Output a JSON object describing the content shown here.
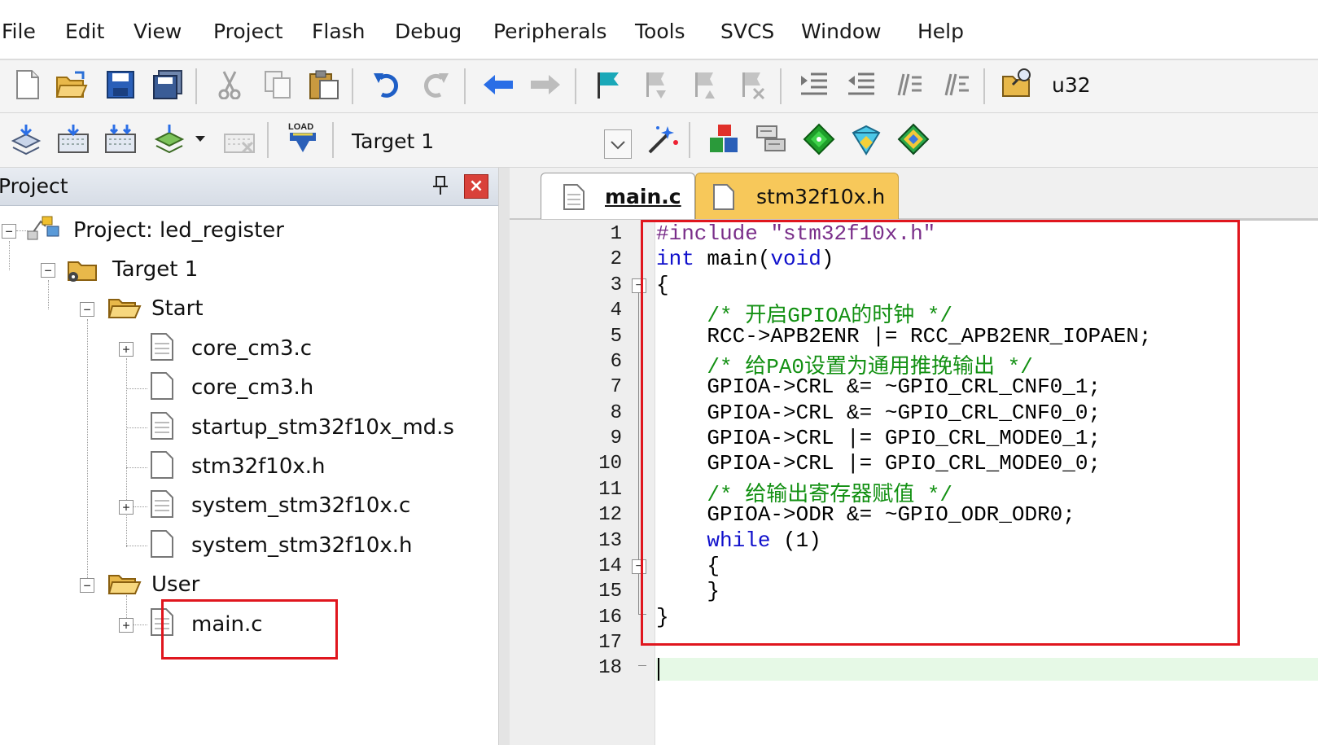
{
  "menu": [
    "File",
    "Edit",
    "View",
    "Project",
    "Flash",
    "Debug",
    "Peripherals",
    "Tools",
    "SVCS",
    "Window",
    "Help"
  ],
  "toolbar1": {
    "search_text": "u32"
  },
  "toolbar2": {
    "target_select": "Target 1"
  },
  "project_panel": {
    "title": "Project",
    "pin_glyph": "♒",
    "close_glyph": "×",
    "tree": {
      "root": "Project: led_register",
      "target": "Target 1",
      "start_group": "Start",
      "start_files": [
        "core_cm3.c",
        "core_cm3.h",
        "startup_stm32f10x_md.s",
        "stm32f10x.h",
        "system_stm32f10x.c",
        "system_stm32f10x.h"
      ],
      "user_group": "User",
      "user_files": [
        "main.c"
      ]
    }
  },
  "editor": {
    "tabs": [
      "main.c",
      "stm32f10x.h"
    ],
    "active_tab": "main.c",
    "line_numbers": [
      "1",
      "2",
      "3",
      "4",
      "5",
      "6",
      "7",
      "8",
      "9",
      "10",
      "11",
      "12",
      "13",
      "14",
      "15",
      "16",
      "17",
      "18"
    ],
    "code": {
      "l1_pre": "#include ",
      "l1_str": "\"stm32f10x.h\"",
      "l2_kw": "int",
      "l2_mid": " main(",
      "l2_kw2": "void",
      "l2_end": ")",
      "l3": "{",
      "l4": "    /* 开启GPIOA的时钟 */",
      "l5": "    RCC->APB2ENR |= RCC_APB2ENR_IOPAEN;",
      "l6": "    /* 给PA0设置为通用推挽输出 */",
      "l7": "    GPIOA->CRL &= ~GPIO_CRL_CNF0_1;",
      "l8": "    GPIOA->CRL &= ~GPIO_CRL_CNF0_0;",
      "l9": "    GPIOA->CRL |= GPIO_CRL_MODE0_1;",
      "l10": "    GPIOA->CRL |= GPIO_CRL_MODE0_0;",
      "l11": "    /* 给输出寄存器赋值 */",
      "l12": "    GPIOA->ODR &= ~GPIO_ODR_ODR0;",
      "l13_kw": "    while",
      "l13_rest": " (1)",
      "l14": "    {",
      "l15": "    }",
      "l16": "}",
      "l17": "",
      "l18": ""
    }
  },
  "colors": {
    "accent_red": "#e0161e",
    "keyword": "#1010cc",
    "comment": "#129012",
    "preprocessor": "#7a2f8a"
  }
}
